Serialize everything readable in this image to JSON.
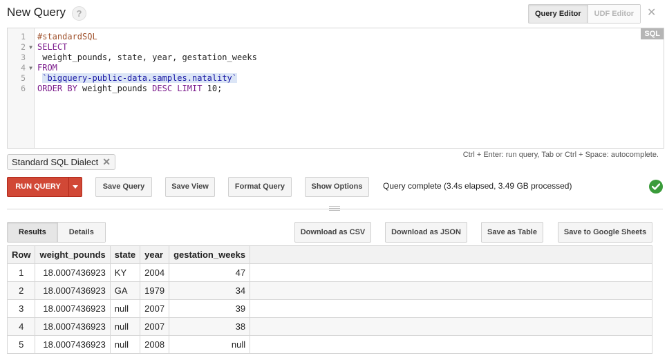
{
  "header": {
    "title": "New Query",
    "help_glyph": "?",
    "tabs": [
      {
        "label": "Query Editor",
        "active": true
      },
      {
        "label": "UDF Editor",
        "active": false
      }
    ],
    "close_glyph": "✕"
  },
  "editor": {
    "language_badge": "SQL",
    "line_numbers": [
      "1",
      "2",
      "3",
      "4",
      "5",
      "6"
    ],
    "lines": {
      "l1": "#standardSQL",
      "l2": "SELECT",
      "l3": " weight_pounds, state, year, gestation_weeks",
      "l4": "FROM",
      "l5_pre": " ",
      "l5_table": "`bigquery-public-data.samples.natality`",
      "l6_kw1": "ORDER BY",
      "l6_mid": " weight_pounds ",
      "l6_kw2": "DESC LIMIT",
      "l6_end": " 10;"
    },
    "hint": "Ctrl + Enter: run query, Tab or Ctrl + Space: autocomplete."
  },
  "dialect_chip": {
    "label": "Standard SQL Dialect",
    "remove_glyph": "✕"
  },
  "toolbar": {
    "run_query": "RUN QUERY",
    "save_query": "Save Query",
    "save_view": "Save View",
    "format_query": "Format Query",
    "show_options": "Show Options",
    "status": "Query complete (3.4s elapsed, 3.49 GB processed)"
  },
  "results": {
    "tabs": [
      {
        "label": "Results",
        "active": true
      },
      {
        "label": "Details",
        "active": false
      }
    ],
    "download_csv": "Download as CSV",
    "download_json": "Download as JSON",
    "save_table": "Save as Table",
    "save_sheets": "Save to Google Sheets",
    "columns": [
      "Row",
      "weight_pounds",
      "state",
      "year",
      "gestation_weeks"
    ],
    "rows": [
      [
        "1",
        "18.0007436923",
        "KY",
        "2004",
        "47"
      ],
      [
        "2",
        "18.0007436923",
        "GA",
        "1979",
        "34"
      ],
      [
        "3",
        "18.0007436923",
        "null",
        "2007",
        "39"
      ],
      [
        "4",
        "18.0007436923",
        "null",
        "2007",
        "38"
      ],
      [
        "5",
        "18.0007436923",
        "null",
        "2008",
        "null"
      ]
    ]
  },
  "colors": {
    "run_button": "#d14836",
    "success": "#3a9b3a",
    "sql_keyword": "#7a1a8b",
    "sql_comment": "#a0522d",
    "sql_string": "#1a1aa6"
  },
  "icons": [
    "help-icon",
    "close-icon",
    "remove-chip-icon",
    "dropdown-caret-icon",
    "success-check-icon",
    "resize-grip-icon"
  ]
}
